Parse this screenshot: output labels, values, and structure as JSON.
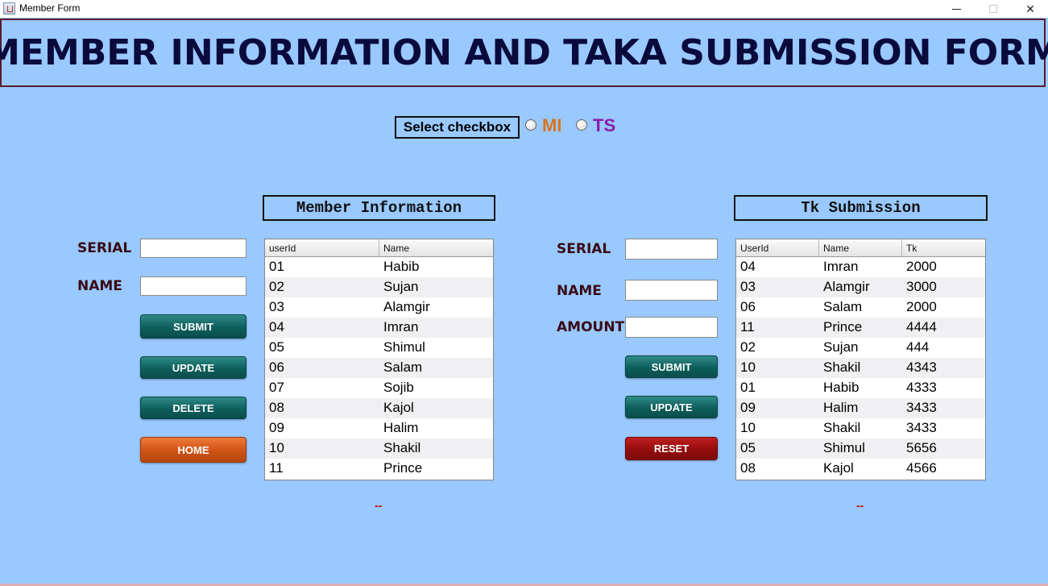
{
  "window": {
    "title": "Member Form"
  },
  "banner": {
    "text": "MEMBER INFORMATION AND TAKA SUBMISSION FORM"
  },
  "selector": {
    "label": "Select checkbox",
    "options": [
      {
        "label": "MI",
        "color": "#d8741e"
      },
      {
        "label": "TS",
        "color": "#8e1aa8"
      }
    ]
  },
  "member_info": {
    "title": "Member Information",
    "labels": {
      "serial": "SERIAL",
      "name": "NAME"
    },
    "inputs": {
      "serial": "",
      "name": ""
    },
    "buttons": {
      "submit": "SUBMIT",
      "update": "UPDATE",
      "delete": "DELETE",
      "home": "HOME"
    },
    "table": {
      "columns": [
        "userId",
        "Name"
      ],
      "rows": [
        [
          "01",
          "Habib"
        ],
        [
          "02",
          "Sujan"
        ],
        [
          "03",
          "Alamgir"
        ],
        [
          "04",
          "Imran"
        ],
        [
          "05",
          "Shimul"
        ],
        [
          "06",
          "Salam"
        ],
        [
          "07",
          "Sojib"
        ],
        [
          "08",
          "Kajol"
        ],
        [
          "09",
          "Halim"
        ],
        [
          "10",
          "Shakil"
        ],
        [
          "11",
          "Prince"
        ]
      ]
    },
    "status": "--"
  },
  "tk_submission": {
    "title": "Tk Submission",
    "labels": {
      "serial": "SERIAL",
      "name": "NAME",
      "amount": "AMOUNT"
    },
    "inputs": {
      "serial": "",
      "name": "",
      "amount": ""
    },
    "buttons": {
      "submit": "SUBMIT",
      "update": "UPDATE",
      "reset": "RESET"
    },
    "table": {
      "columns": [
        "UserId",
        "Name",
        "Tk"
      ],
      "rows": [
        [
          "04",
          "Imran",
          "2000"
        ],
        [
          "03",
          "Alamgir",
          "3000"
        ],
        [
          "06",
          "Salam",
          "2000"
        ],
        [
          "11",
          "Prince",
          "4444"
        ],
        [
          "02",
          "Sujan",
          "444"
        ],
        [
          "10",
          "Shakil",
          "4343"
        ],
        [
          "01",
          "Habib",
          "4333"
        ],
        [
          "09",
          "Halim",
          "3433"
        ],
        [
          "10",
          "Shakil",
          "3433"
        ],
        [
          "05",
          "Shimul",
          "5656"
        ],
        [
          "08",
          "Kajol",
          "4566"
        ]
      ]
    },
    "status": "--"
  },
  "colors": {
    "background": "#99c9ff",
    "banner_text": "#0a0a3c",
    "label_text": "#3a0a14",
    "teal_button": "#0d5e5c",
    "orange_button": "#cf5314",
    "red_button": "#940c0c",
    "status_text": "#cc0000"
  }
}
